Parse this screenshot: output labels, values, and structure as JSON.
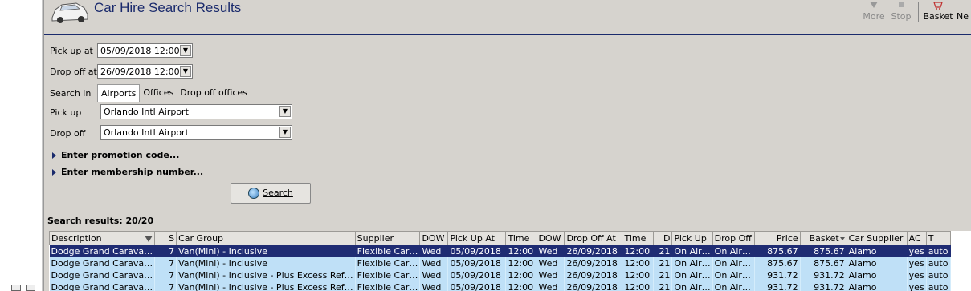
{
  "header": {
    "title": "Car Hire Search Results",
    "toolbar": [
      {
        "label": "More",
        "icon": "more-arrow-icon",
        "enabled": false
      },
      {
        "label": "Stop",
        "icon": "stop-icon",
        "enabled": false
      },
      {
        "label": "Basket",
        "icon": "basket-icon",
        "enabled": true
      },
      {
        "label": "Ne",
        "icon": "new-icon",
        "enabled": true
      }
    ]
  },
  "form": {
    "pickup_at_label": "Pick up at",
    "pickup_at_value": "05/09/2018 12:00",
    "dropoff_at_label": "Drop off at",
    "dropoff_at_value": "26/09/2018 12:00",
    "search_in_label": "Search in",
    "search_in_tabs": [
      "Airports",
      "Offices",
      "Drop off offices"
    ],
    "pickup_label": "Pick up",
    "pickup_value": "Orlando Intl Airport",
    "dropoff_label": "Drop off",
    "dropoff_value": "Orlando Intl Airport",
    "promo_label": "Enter promotion code...",
    "membership_label": "Enter membership number...",
    "search_button": "Search"
  },
  "results": {
    "label": "Search results: 20/20",
    "columns": [
      "Description",
      "S",
      "Car Group",
      "Supplier",
      "DOW",
      "Pick Up At",
      "Time",
      "DOW",
      "Drop Off At",
      "Time",
      "D",
      "Pick Up",
      "Drop Off",
      "Price",
      "Basket",
      "Car Supplier",
      "AC",
      "T"
    ],
    "rows": [
      [
        "Dodge Grand Carava…",
        "7",
        "Van(Mini) - Inclusive",
        "Flexible Car…",
        "Wed",
        "05/09/2018",
        "12:00",
        "Wed",
        "26/09/2018",
        "12:00",
        "21",
        "On Air…",
        "On Air…",
        "875.67",
        "875.67",
        "Alamo",
        "yes",
        "auto"
      ],
      [
        "Dodge Grand Carava…",
        "7",
        "Van(Mini) - Inclusive",
        "Flexible Car…",
        "Wed",
        "05/09/2018",
        "12:00",
        "Wed",
        "26/09/2018",
        "12:00",
        "21",
        "On Air…",
        "On Air…",
        "875.67",
        "875.67",
        "Alamo",
        "yes",
        "auto"
      ],
      [
        "Dodge Grand Carava…",
        "7",
        "Van(Mini) - Inclusive - Plus Excess Ref…",
        "Flexible Car…",
        "Wed",
        "05/09/2018",
        "12:00",
        "Wed",
        "26/09/2018",
        "12:00",
        "21",
        "On Air…",
        "On Air…",
        "931.72",
        "931.72",
        "Alamo",
        "yes",
        "auto"
      ],
      [
        "Dodge Grand Carava…",
        "7",
        "Van(Mini) - Inclusive - Plus Excess Ref…",
        "Flexible Car…",
        "Wed",
        "05/09/2018",
        "12:00",
        "Wed",
        "26/09/2018",
        "12:00",
        "21",
        "On Air…",
        "On Air…",
        "931.72",
        "931.72",
        "Alamo",
        "yes",
        "auto"
      ]
    ],
    "selected_row": 0
  },
  "colors": {
    "accent": "#1a2a6c",
    "selected_row_bg": "#1f2c73",
    "row_bg": "#bfe0f7",
    "panel_bg": "#d6d3ce"
  }
}
